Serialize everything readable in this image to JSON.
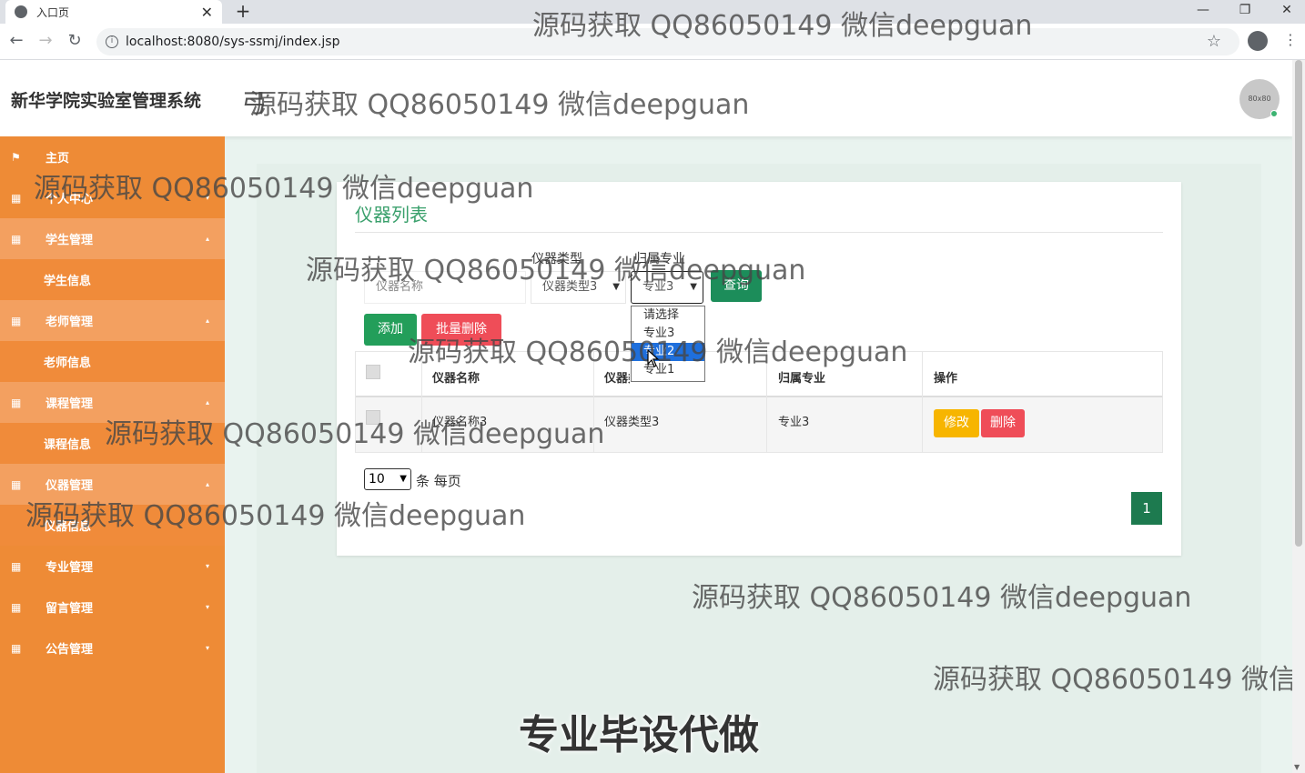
{
  "browser": {
    "tab_title": "入口页",
    "new_tab": "+",
    "url": "localhost:8080/sys-ssmj/index.jsp",
    "window_controls": [
      "—",
      "❐",
      "✕"
    ]
  },
  "app": {
    "brand": "新华学院实验室管理系统",
    "header_prefix": "弓",
    "avatar_label": "80x80"
  },
  "sidebar": {
    "items": [
      {
        "label": "主页",
        "icon": "flag-icon"
      },
      {
        "label": "个人中心",
        "icon": "grid-icon",
        "caret": "▾"
      },
      {
        "label": "学生管理",
        "icon": "grid-icon",
        "caret": "▴"
      },
      {
        "label": "学生信息",
        "sub": true
      },
      {
        "label": "老师管理",
        "icon": "grid-icon",
        "caret": "▴"
      },
      {
        "label": "老师信息",
        "sub": true
      },
      {
        "label": "课程管理",
        "icon": "grid-icon",
        "caret": "▴"
      },
      {
        "label": "课程信息",
        "sub": true
      },
      {
        "label": "仪器管理",
        "icon": "grid-icon",
        "caret": "▴"
      },
      {
        "label": "仪器信息",
        "sub": true
      },
      {
        "label": "专业管理",
        "icon": "grid-icon",
        "caret": "▾"
      },
      {
        "label": "留言管理",
        "icon": "grid-icon",
        "caret": "▾"
      },
      {
        "label": "公告管理",
        "icon": "grid-icon",
        "caret": "▾"
      }
    ]
  },
  "main": {
    "title": "仪器列表",
    "filters": {
      "type_label": "仪器类型",
      "major_label": "归属专业",
      "name_placeholder": "仪器名称",
      "type_value": "仪器类型3",
      "major_value": "专业3",
      "query_button": "查询"
    },
    "dropdown_options": [
      "请选择",
      "专业3",
      "专业2",
      "专业1"
    ],
    "dropdown_selected_index": 2,
    "actions": {
      "add": "添加",
      "batch_delete": "批量删除"
    },
    "table": {
      "headers": [
        "仪器名称",
        "仪器类型",
        "归属专业",
        "操作"
      ],
      "rows": [
        {
          "name": "仪器名称3",
          "type": "仪器类型3",
          "major": "专业3",
          "edit": "修改",
          "delete": "删除"
        }
      ]
    },
    "pagination": {
      "page_size": "10",
      "per_page_label": "条 每页",
      "current_page": "1"
    }
  },
  "watermarks": {
    "text": "源码获取 QQ86050149 微信deepguan",
    "text_cut": "源码获取 QQ86050149 微信d",
    "banner": "专业毕设代做"
  }
}
